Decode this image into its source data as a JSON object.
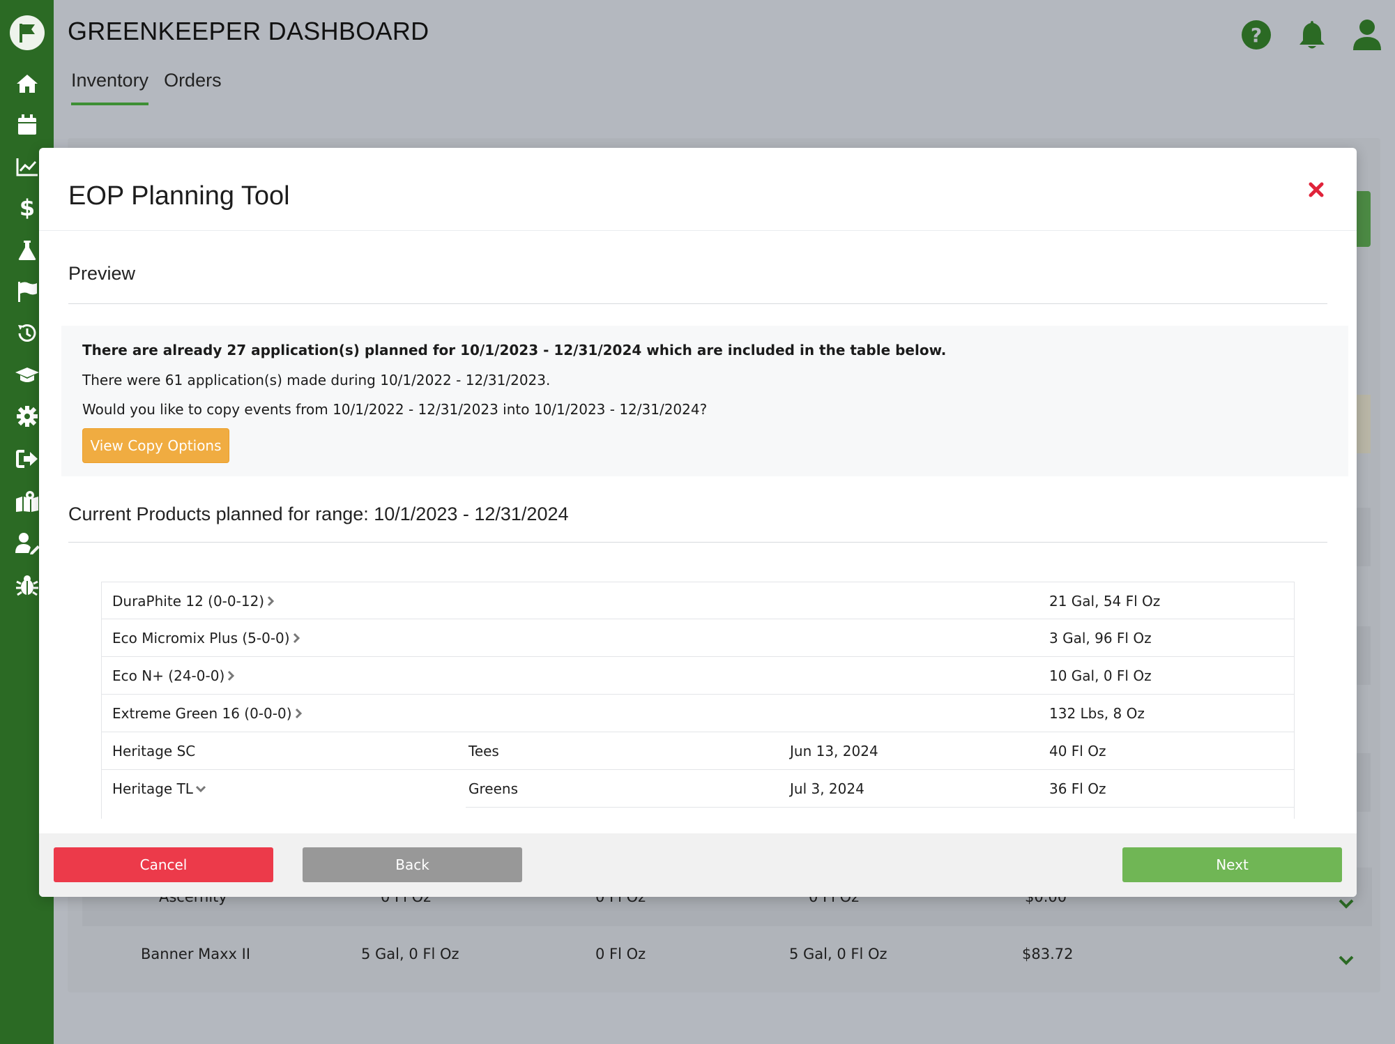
{
  "app": {
    "title": "GREENKEEPER DASHBOARD",
    "tabs": [
      {
        "label": "Inventory",
        "active": true
      },
      {
        "label": "Orders",
        "active": false
      }
    ]
  },
  "sidebar": {
    "icons": [
      "flag-logo-icon",
      "home-icon",
      "calendar-icon",
      "chart-icon",
      "dollar-icon",
      "flask-icon",
      "flag-icon",
      "history-icon",
      "graduation-cap-icon",
      "gear-icon",
      "sign-out-icon",
      "map-icon",
      "user-edit-icon",
      "bug-icon"
    ]
  },
  "header_icons": [
    "help-icon",
    "bell-icon",
    "user-icon"
  ],
  "background_rows": [
    {
      "name": "Ascernity",
      "c1": "0 Fl Oz",
      "c2": "0 Fl Oz",
      "c3": "0 Fl Oz",
      "c4": "$0.00"
    },
    {
      "name": "Banner Maxx II",
      "c1": "5 Gal, 0 Fl Oz",
      "c2": "0 Fl Oz",
      "c3": "5 Gal, 0 Fl Oz",
      "c4": "$83.72"
    }
  ],
  "modal": {
    "title": "EOP Planning Tool",
    "preview_title": "Preview",
    "info": {
      "line1": "There are already 27 application(s) planned for 10/1/2023 - 12/31/2024 which are included in the table below.",
      "line2": "There were 61 application(s) made during 10/1/2022 - 12/31/2023.",
      "line3": "Would you like to copy events from 10/1/2022 - 12/31/2023 into 10/1/2023 - 12/31/2024?",
      "copy_button": "View Copy Options"
    },
    "products_title": "Current Products planned for range: 10/1/2023 - 12/31/2024",
    "products": [
      {
        "name": "DuraPhite 12 (0-0-12)",
        "chevron": "right",
        "area": "",
        "date": "",
        "amount": "21 Gal, 54 Fl Oz"
      },
      {
        "name": "Eco Micromix Plus (5-0-0)",
        "chevron": "right",
        "area": "",
        "date": "",
        "amount": "3 Gal, 96 Fl Oz"
      },
      {
        "name": "Eco N+ (24-0-0)",
        "chevron": "right",
        "area": "",
        "date": "",
        "amount": "10 Gal, 0 Fl Oz"
      },
      {
        "name": "Extreme Green 16 (0-0-0)",
        "chevron": "right",
        "area": "",
        "date": "",
        "amount": "132 Lbs, 8 Oz"
      },
      {
        "name": "Heritage SC",
        "chevron": "",
        "area": "Tees",
        "date": "Jun 13, 2024",
        "amount": "40 Fl Oz"
      },
      {
        "name": "Heritage TL",
        "chevron": "down",
        "area": "Greens",
        "date": "Jul 3, 2024",
        "amount": "36 Fl Oz"
      }
    ],
    "footer": {
      "cancel": "Cancel",
      "back": "Back",
      "next": "Next"
    }
  },
  "colors": {
    "sidebar": "#2b6a24",
    "accent_green": "#70b655",
    "cancel_red": "#ec3a4a",
    "copy_orange": "#f0ac41",
    "close_red": "#e0233a"
  }
}
